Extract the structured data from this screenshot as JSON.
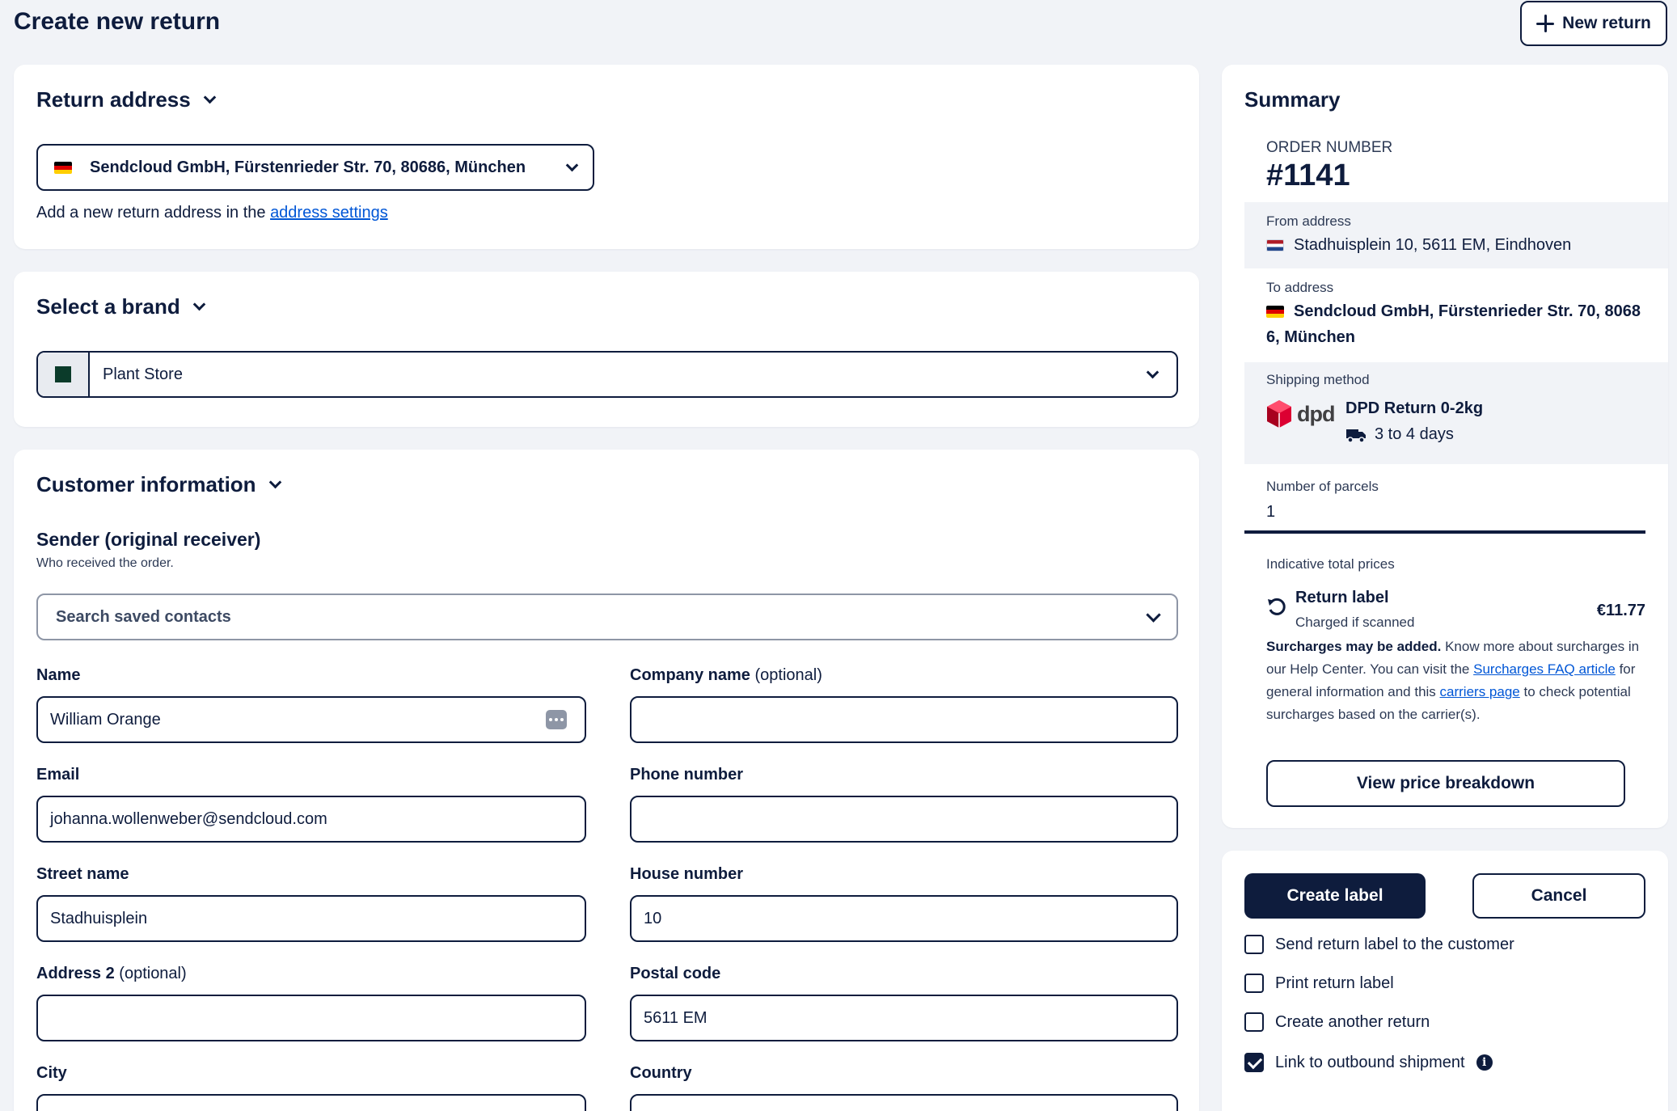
{
  "page": {
    "title": "Create new return",
    "new_return_label": "New return"
  },
  "return_address": {
    "heading": "Return address",
    "selected": "Sendcloud GmbH, Fürstenrieder Str. 70, 80686, München",
    "hint_prefix": "Add a new return address in the ",
    "hint_link": "address settings"
  },
  "brand": {
    "heading": "Select a brand",
    "selected": "Plant Store",
    "swatch_color": "#0b3b2a"
  },
  "customer": {
    "heading": "Customer information",
    "sender_title": "Sender (original receiver)",
    "sender_subtitle": "Who received the order.",
    "search_placeholder": "Search saved contacts",
    "fields": {
      "name_label": "Name",
      "name_value": "William Orange",
      "company_label": "Company name",
      "company_optional": "(optional)",
      "company_value": "",
      "email_label": "Email",
      "email_value": "johanna.wollenweber@sendcloud.com",
      "phone_label": "Phone number",
      "phone_value": "",
      "street_label": "Street name",
      "street_value": "Stadhuisplein",
      "house_label": "House number",
      "house_value": "10",
      "address2_label": "Address 2",
      "address2_optional": "(optional)",
      "address2_value": "",
      "postal_label": "Postal code",
      "postal_value": "5611 EM",
      "city_label": "City",
      "country_label": "Country"
    }
  },
  "summary": {
    "heading": "Summary",
    "order_number_label": "ORDER NUMBER",
    "order_number": "#1141",
    "from_label": "From address",
    "from_value": "Stadhuisplein 10, 5611 EM, Eindhoven",
    "to_label": "To address",
    "to_value_line1": "Sendcloud GmbH, Fürstenrieder Str. 70, 8068",
    "to_value_line2": "6, München",
    "shipping_label": "Shipping method",
    "carrier_logo_text": "dpd",
    "shipping_method": "DPD Return 0-2kg",
    "shipping_time": "3 to 4 days",
    "parcels_label": "Number of parcels",
    "parcels_value": "1",
    "prices_label": "Indicative total prices",
    "return_label_title": "Return label",
    "return_label_sub": "Charged if scanned",
    "return_label_price": "€11.77",
    "surcharge_bold": "Surcharges may be added.",
    "surcharge_text1": " Know more about surcharges in our Help Center. You can visit the ",
    "surcharge_link1": "Surcharges FAQ article",
    "surcharge_text2": " for general information and this ",
    "surcharge_link2": "carriers page",
    "surcharge_text3": " to check potential surcharges based on the carrier(s).",
    "breakdown_button": "View price breakdown"
  },
  "actions": {
    "create_label": "Create label",
    "cancel": "Cancel",
    "options": [
      {
        "label": "Send return label to the customer",
        "checked": false
      },
      {
        "label": "Print return label",
        "checked": false
      },
      {
        "label": "Create another return",
        "checked": false
      },
      {
        "label": "Link to outbound shipment",
        "checked": true
      }
    ]
  },
  "colors": {
    "navy": "#0e1c3d",
    "background": "#f1f3f7",
    "link": "#0056d6",
    "dpd_red": "#dc0032"
  }
}
